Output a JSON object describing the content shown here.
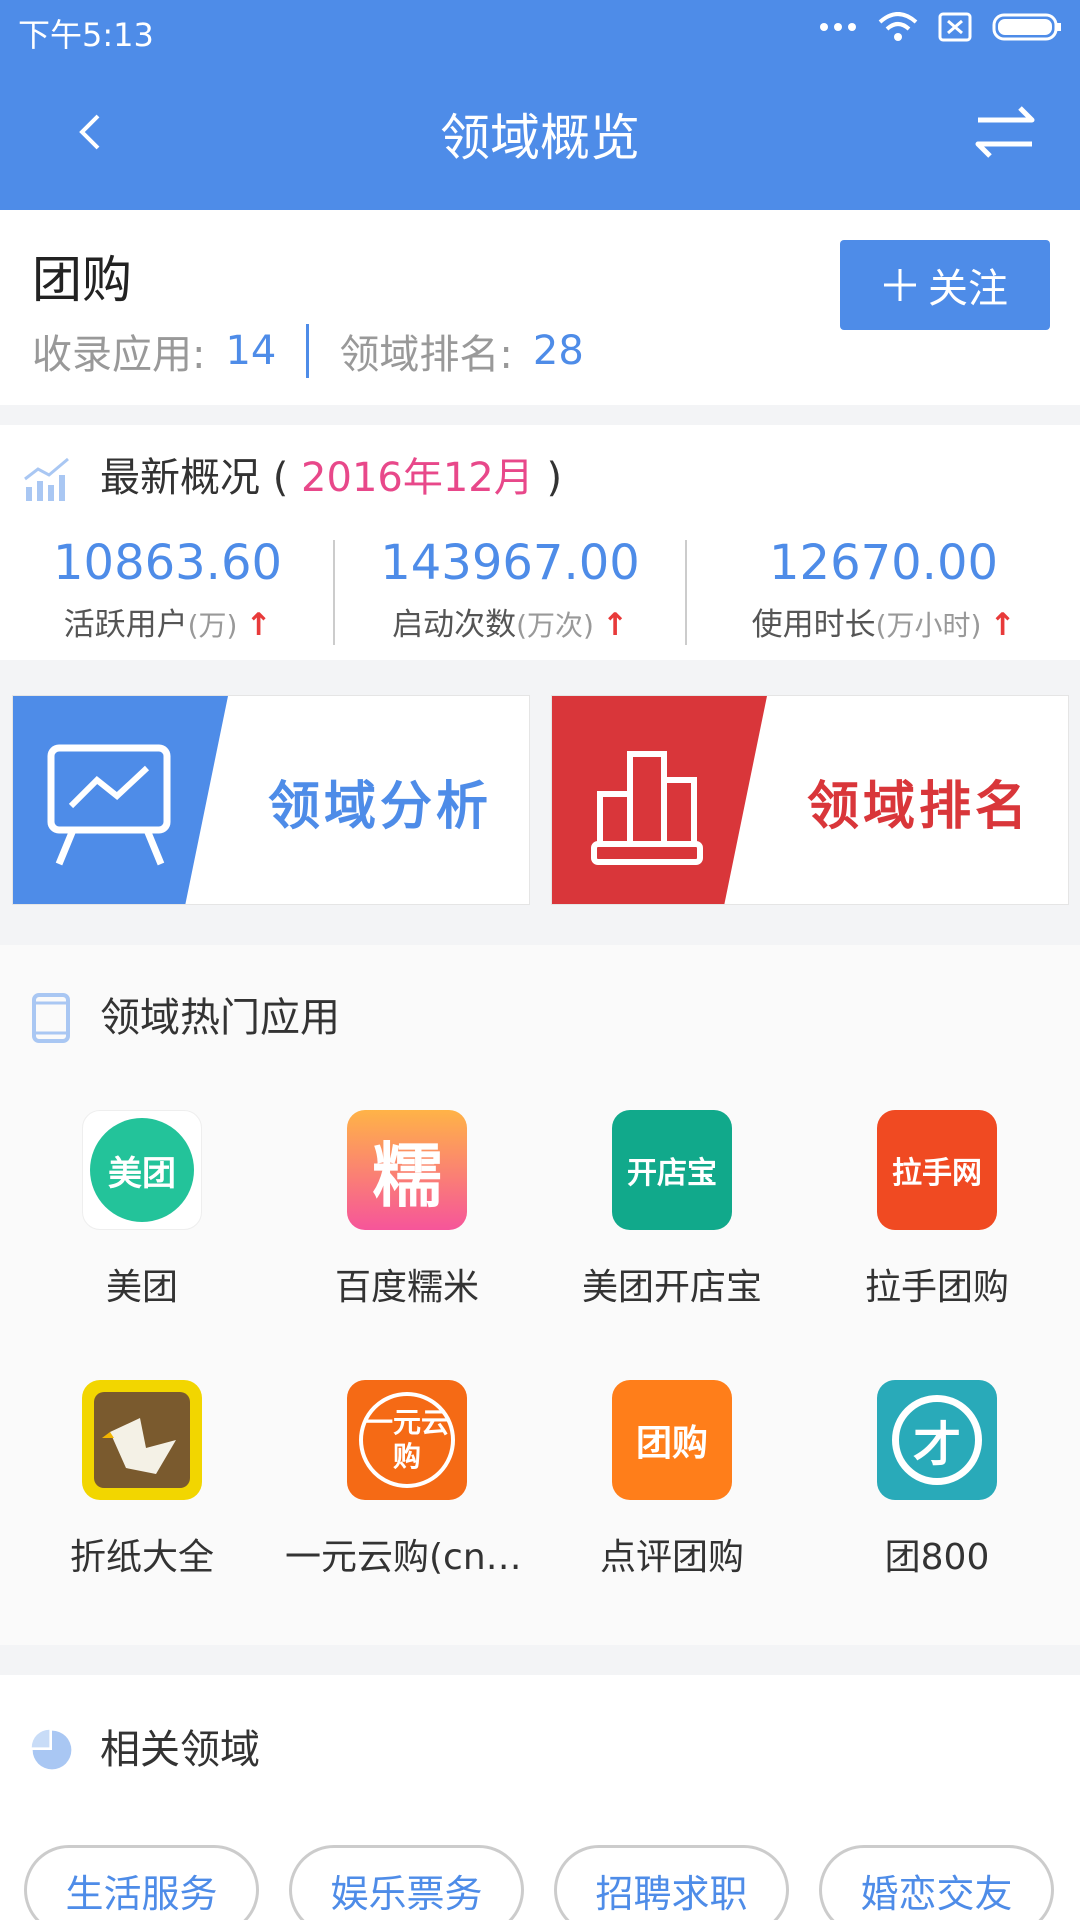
{
  "status_bar": {
    "time": "下午5:13"
  },
  "nav": {
    "title": "领域概览"
  },
  "header": {
    "name": "团购",
    "apps_label": "收录应用:",
    "apps_count": "14",
    "rank_label": "领域排名:",
    "rank": "28",
    "follow_label": "关注"
  },
  "overview": {
    "title": "最新概况",
    "paren_open": "(",
    "paren_close": ")",
    "date": "2016年12月",
    "stats": [
      {
        "value": "10863.60",
        "label": "活跃用户",
        "unit": "(万)",
        "trend": "↑"
      },
      {
        "value": "143967.00",
        "label": "启动次数",
        "unit": "(万次)",
        "trend": "↑"
      },
      {
        "value": "12670.00",
        "label": "使用时长",
        "unit": "(万小时)",
        "trend": "↑"
      }
    ]
  },
  "cards": [
    {
      "label": "领域分析",
      "color": "#4e8ce8"
    },
    {
      "label": "领域排名",
      "color": "#d9363a"
    }
  ],
  "hot_apps": {
    "title": "领域热门应用",
    "apps": [
      {
        "name": "美团",
        "logo_text": "美团",
        "color": "#23c39a"
      },
      {
        "name": "百度糯米",
        "logo_text": "糯",
        "color": "#f6559a"
      },
      {
        "name": "美团开店宝",
        "logo_text": "开店宝",
        "color": "#11a98b"
      },
      {
        "name": "拉手团购",
        "logo_text": "拉手网",
        "color": "#f04a22"
      },
      {
        "name": "折纸大全",
        "logo_text": "",
        "color": "#f2d600"
      },
      {
        "name": "一元云购(cn.…",
        "logo_text": "一元云购",
        "color": "#f56a15"
      },
      {
        "name": "点评团购",
        "logo_text": "团购",
        "color": "#ff7e1a"
      },
      {
        "name": "团800",
        "logo_text": "才",
        "color": "#29aab9"
      }
    ]
  },
  "related": {
    "title": "相关领域",
    "tags": [
      "生活服务",
      "娱乐票务",
      "招聘求职",
      "婚恋交友"
    ]
  }
}
